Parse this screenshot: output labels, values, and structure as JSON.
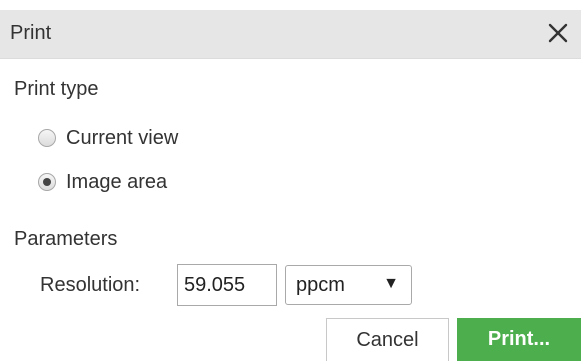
{
  "dialog": {
    "title": "Print",
    "close_icon": "close-icon"
  },
  "print_type": {
    "label": "Print type",
    "options": [
      {
        "label": "Current view",
        "checked": false
      },
      {
        "label": "Image area",
        "checked": true
      }
    ]
  },
  "parameters": {
    "label": "Parameters",
    "resolution_label": "Resolution:",
    "resolution_value": "59.055",
    "unit_selected": "ppcm",
    "unit_arrow": "▼"
  },
  "buttons": {
    "cancel": "Cancel",
    "print": "Print..."
  },
  "colors": {
    "titlebar_bg": "#e6e6e6",
    "print_button_bg": "#4cae4c"
  }
}
